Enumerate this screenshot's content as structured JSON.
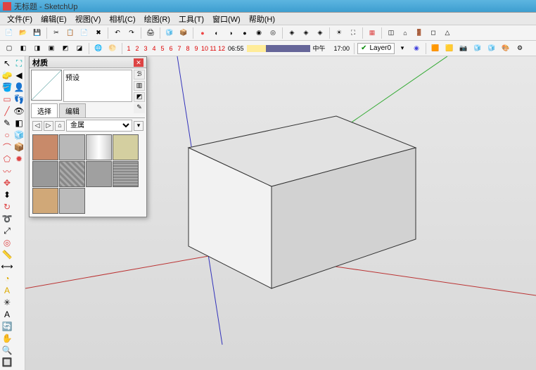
{
  "title": "无标题 - SketchUp",
  "menu": {
    "file": "文件(F)",
    "edit": "编辑(E)",
    "view": "视图(V)",
    "camera": "相机(C)",
    "draw": "绘图(R)",
    "tools": "工具(T)",
    "window": "窗口(W)",
    "help": "帮助(H)"
  },
  "ruler": {
    "n1": "1",
    "n2": "2",
    "n3": "3",
    "n4": "4",
    "n5": "5",
    "n6": "6",
    "n7": "7",
    "n8": "8",
    "n9": "9",
    "n10": "10",
    "n11": "11",
    "n12": "12"
  },
  "time": {
    "t1": "06:55",
    "t2": "中午",
    "t3": "17:00"
  },
  "layer": {
    "name": "Layer0"
  },
  "materials": {
    "title": "材质",
    "preset_label": "预设",
    "tab_select": "选择",
    "tab_edit": "编辑",
    "category": "金属",
    "swatches": [
      {
        "c": "#c88a6a"
      },
      {
        "c": "#b8b8b8"
      },
      {
        "c": "linear-gradient(90deg,#ccc,#fff,#ccc)"
      },
      {
        "c": "#d4cfa0"
      },
      {
        "c": "#999"
      },
      {
        "c": "repeating-linear-gradient(45deg,#888,#888 3px,#aaa 3px,#aaa 6px)"
      },
      {
        "c": "#a0a0a0"
      },
      {
        "c": "repeating-linear-gradient(0deg,#888,#888 2px,#aaa 2px,#aaa 4px)"
      },
      {
        "c": "#d0a878"
      },
      {
        "c": "#bbb"
      }
    ]
  }
}
